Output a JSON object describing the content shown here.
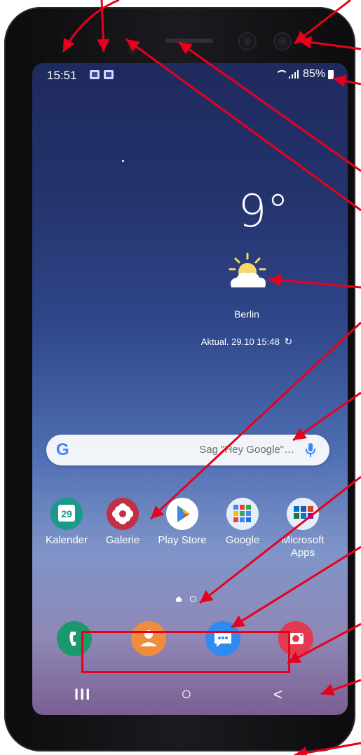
{
  "status_bar": {
    "time": "15:51",
    "battery": "85%",
    "icons": [
      "outlook-icon",
      "outlook-icon",
      "wifi-icon",
      "signal-icon",
      "battery-icon"
    ]
  },
  "weather": {
    "temperature": "9°",
    "city": "Berlin",
    "updated": "Aktual. 29.10 15:48",
    "icon": "partly-sunny-icon"
  },
  "search": {
    "logo": "G",
    "hint": "Sag \"Hey Google\"…",
    "icon": "mic-icon"
  },
  "apps": [
    {
      "label": "Kalender",
      "badge": "29",
      "color": "#1a9a8a"
    },
    {
      "label": "Galerie",
      "color": "#c23046"
    },
    {
      "label": "Play Store",
      "color": "#ffffff"
    },
    {
      "label": "Google",
      "color": "#e8eef9"
    },
    {
      "label": "Microsoft Apps",
      "color": "#e8eef9"
    }
  ],
  "dock": [
    {
      "name": "phone-icon",
      "color": "#1a9a6c"
    },
    {
      "name": "contacts-icon",
      "color": "#f08d3c"
    },
    {
      "name": "messages-icon",
      "color": "#2f8af2"
    },
    {
      "name": "camera-icon",
      "color": "#e23b4f"
    }
  ],
  "navigation": {
    "recents": "III",
    "home": "○",
    "back": "<"
  },
  "colors": {
    "annotation": "#e8001c",
    "accent": "#2f8af2"
  }
}
